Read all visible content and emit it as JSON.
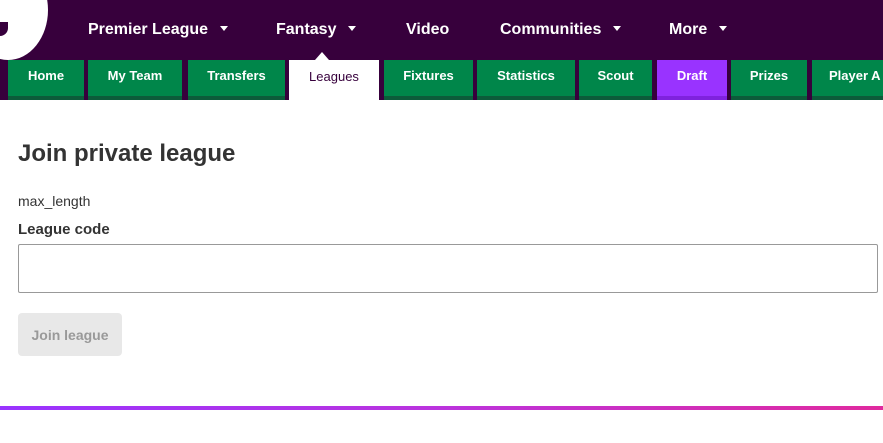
{
  "topnav": {
    "items": [
      {
        "label": "Premier League",
        "has_dropdown": true
      },
      {
        "label": "Fantasy",
        "has_dropdown": true
      },
      {
        "label": "Video",
        "has_dropdown": false
      },
      {
        "label": "Communities",
        "has_dropdown": true
      },
      {
        "label": "More",
        "has_dropdown": true
      }
    ]
  },
  "subnav": {
    "tabs": [
      {
        "label": "Home"
      },
      {
        "label": "My Team"
      },
      {
        "label": "Transfers"
      },
      {
        "label": "Leagues",
        "active": true
      },
      {
        "label": "Fixtures"
      },
      {
        "label": "Statistics"
      },
      {
        "label": "Scout"
      },
      {
        "label": "Draft"
      },
      {
        "label": "Prizes"
      },
      {
        "label": "Player A"
      }
    ]
  },
  "main": {
    "title": "Join private league",
    "note": "max_length",
    "field_label": "League code",
    "field_value": "",
    "join_button": "Join league"
  },
  "colors": {
    "brand_purple": "#37003c",
    "tab_green": "#00864a",
    "draft_purple": "#9933ff",
    "disabled_button": "#e8e8e8"
  }
}
